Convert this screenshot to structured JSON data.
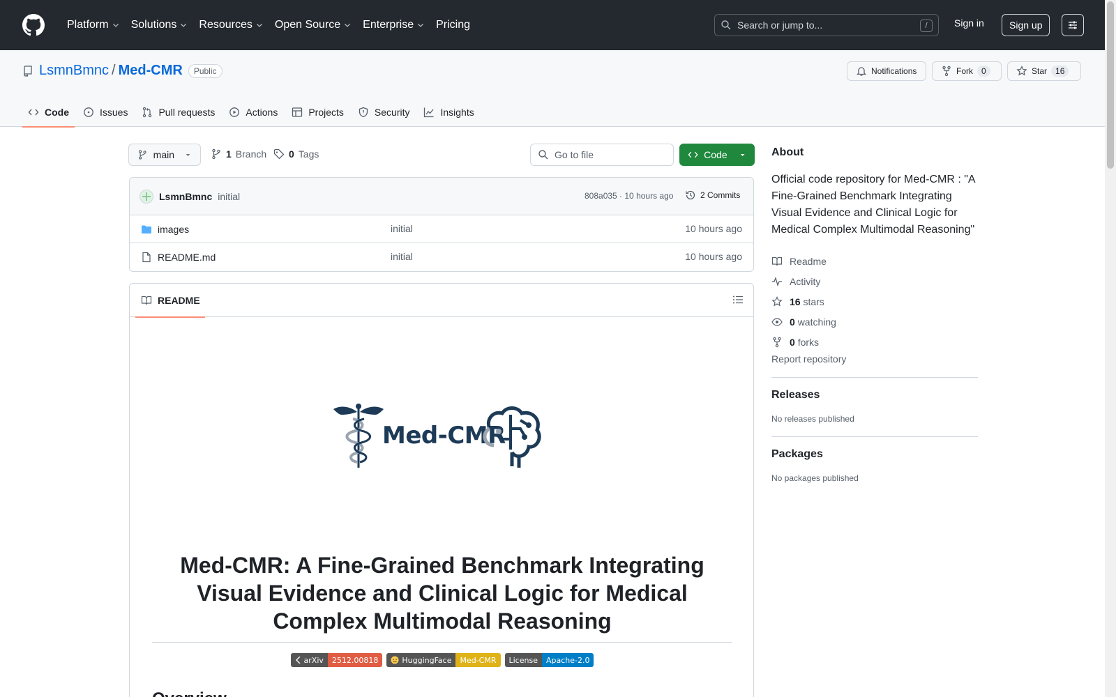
{
  "header": {
    "nav": [
      "Platform",
      "Solutions",
      "Resources",
      "Open Source",
      "Enterprise",
      "Pricing"
    ],
    "search_placeholder": "Search or jump to...",
    "slash": "/",
    "signin": "Sign in",
    "signup": "Sign up"
  },
  "repo": {
    "owner": "LsmnBmnc",
    "sep": "/",
    "name": "Med-CMR",
    "visibility": "Public",
    "notifications": "Notifications",
    "fork_label": "Fork",
    "fork_count": "0",
    "star_label": "Star",
    "star_count": "16"
  },
  "tabs": [
    "Code",
    "Issues",
    "Pull requests",
    "Actions",
    "Projects",
    "Security",
    "Insights"
  ],
  "branchbar": {
    "branch": "main",
    "branches_count": "1",
    "branches_label": "Branch",
    "tags_count": "0",
    "tags_label": "Tags",
    "goto_placeholder": "Go to file",
    "code_btn": "Code"
  },
  "commit": {
    "author": "LsmnBmnc",
    "message": "initial",
    "meta": "808a035 · 10 hours ago",
    "commits": "2 Commits"
  },
  "files": [
    {
      "name": "images",
      "type": "folder",
      "message": "initial",
      "time": "10 hours ago"
    },
    {
      "name": "README.md",
      "type": "file",
      "message": "initial",
      "time": "10 hours ago"
    }
  ],
  "readme": {
    "tab": "README",
    "logo_text": "Med-CMR",
    "title": "Med-CMR: A Fine-Grained Benchmark Integrating Visual Evidence and Clinical Logic for Medical Complex Multimodal Reasoning",
    "badges": [
      {
        "label": "arXiv",
        "value": "2512.00818",
        "color": "#e05d44"
      },
      {
        "label": "HuggingFace",
        "value": "Med-CMR",
        "color": "#dfb317"
      },
      {
        "label": "License",
        "value": "Apache-2.0",
        "color": "#007ec6"
      }
    ],
    "next_heading": "Overview"
  },
  "sidebar": {
    "about": "About",
    "description": "Official code repository for Med-CMR : \"A Fine-Grained Benchmark Integrating Visual Evidence and Clinical Logic for Medical Complex Multimodal Reasoning\"",
    "readme": "Readme",
    "activity": "Activity",
    "stars_count": "16",
    "stars_label": "stars",
    "watching_count": "0",
    "watching_label": "watching",
    "forks_count": "0",
    "forks_label": "forks",
    "report": "Report repository",
    "releases": "Releases",
    "no_releases": "No releases published",
    "packages": "Packages",
    "no_packages": "No packages published"
  },
  "colors": {
    "header_bg": "#24292f",
    "link": "#0969da",
    "green_button": "#1f883d",
    "tab_underline": "#fd8c73"
  }
}
